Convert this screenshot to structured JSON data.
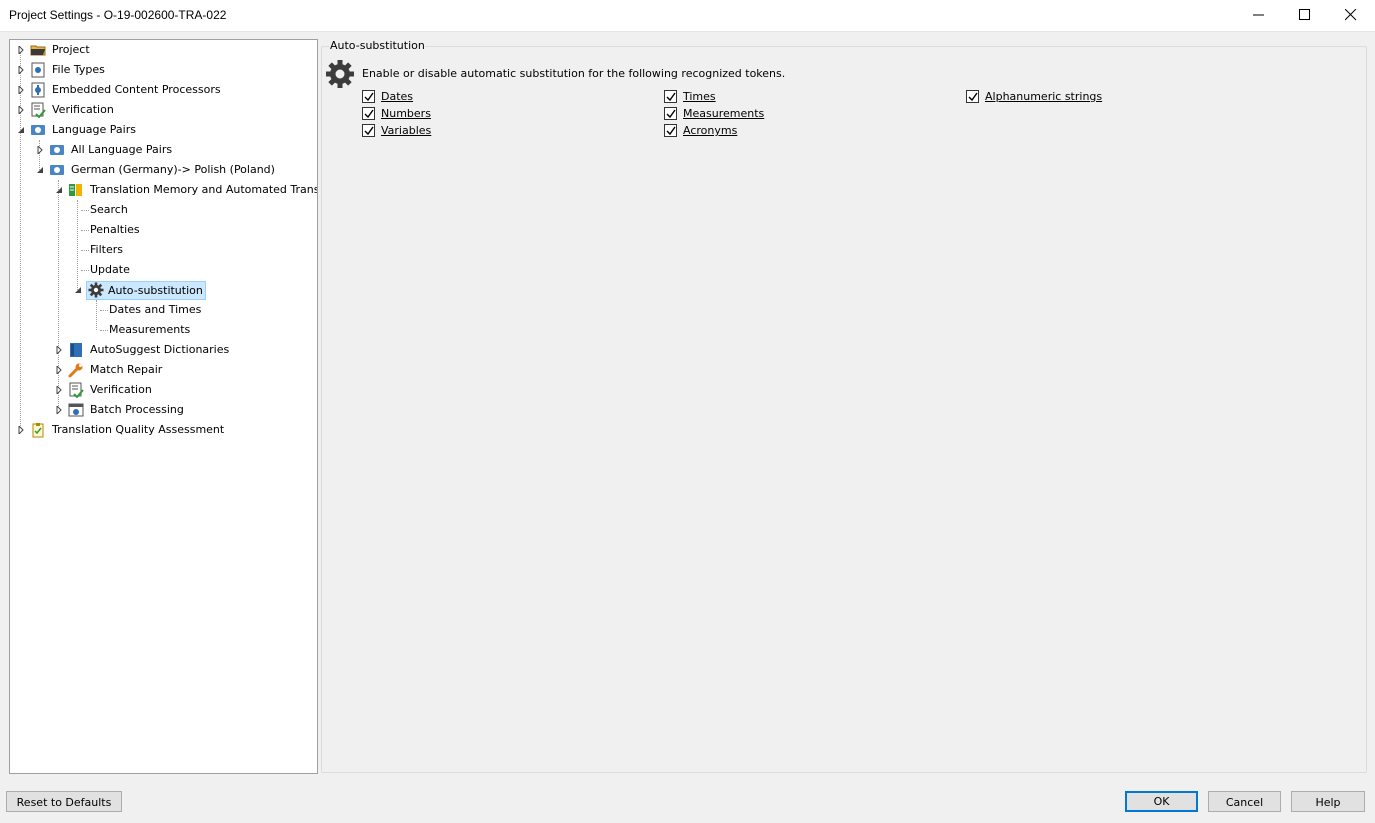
{
  "window": {
    "title": "Project Settings - O-19-002600-TRA-022",
    "minimize_icon": "minimize-icon",
    "maximize_icon": "maximize-icon",
    "close_icon": "close-icon"
  },
  "tree": {
    "items": [
      {
        "label": "Project",
        "icon": "project-folder-icon",
        "level": 0,
        "expander": "collapsed"
      },
      {
        "label": "File Types",
        "icon": "file-types-icon",
        "level": 0,
        "expander": "collapsed"
      },
      {
        "label": "Embedded Content Processors",
        "icon": "embedded-content-icon",
        "level": 0,
        "expander": "collapsed"
      },
      {
        "label": "Verification",
        "icon": "verification-icon",
        "level": 0,
        "expander": "collapsed"
      },
      {
        "label": "Language Pairs",
        "icon": "language-pairs-icon",
        "level": 0,
        "expander": "expanded"
      },
      {
        "label": "All Language Pairs",
        "icon": "language-pairs-icon",
        "level": 1,
        "expander": "collapsed"
      },
      {
        "label": "German (Germany)-> Polish (Poland)",
        "icon": "language-pairs-icon",
        "level": 1,
        "expander": "expanded"
      },
      {
        "label": "Translation Memory and Automated Translati",
        "icon": "translation-memory-icon",
        "level": 2,
        "expander": "expanded"
      },
      {
        "label": "Search",
        "icon": "",
        "level": 3,
        "expander": "none"
      },
      {
        "label": "Penalties",
        "icon": "",
        "level": 3,
        "expander": "none"
      },
      {
        "label": "Filters",
        "icon": "",
        "level": 3,
        "expander": "none"
      },
      {
        "label": "Update",
        "icon": "",
        "level": 3,
        "expander": "none"
      },
      {
        "label": "Auto-substitution",
        "icon": "gear-icon",
        "level": 3,
        "expander": "expanded",
        "selected": true
      },
      {
        "label": "Dates and Times",
        "icon": "",
        "level": 4,
        "expander": "none"
      },
      {
        "label": "Measurements",
        "icon": "",
        "level": 4,
        "expander": "none"
      },
      {
        "label": "AutoSuggest Dictionaries",
        "icon": "autosuggest-dictionary-icon",
        "level": 2,
        "expander": "collapsed"
      },
      {
        "label": "Match Repair",
        "icon": "wrench-icon",
        "level": 2,
        "expander": "collapsed"
      },
      {
        "label": "Verification",
        "icon": "verification-icon",
        "level": 2,
        "expander": "collapsed"
      },
      {
        "label": "Batch Processing",
        "icon": "batch-processing-icon",
        "level": 2,
        "expander": "collapsed"
      },
      {
        "label": "Translation Quality Assessment",
        "icon": "quality-assessment-icon",
        "level": 0,
        "expander": "collapsed"
      }
    ]
  },
  "panel": {
    "title": "Auto-substitution",
    "description": "Enable or disable automatic substitution for the following recognized tokens.",
    "icon": "gear-icon",
    "checkboxes": [
      {
        "label": "Dates",
        "checked": true
      },
      {
        "label": "Numbers",
        "checked": true
      },
      {
        "label": "Variables",
        "checked": true
      },
      {
        "label": "Times",
        "checked": true
      },
      {
        "label": "Measurements",
        "checked": true
      },
      {
        "label": "Acronyms",
        "checked": true
      },
      {
        "label": "Alphanumeric strings",
        "checked": true
      }
    ]
  },
  "buttons": {
    "reset": "Reset to Defaults",
    "ok": "OK",
    "cancel": "Cancel",
    "help": "Help"
  },
  "colors": {
    "selection_bg": "#cce8ff",
    "selection_border": "#99d1ff",
    "default_button_border": "#0078d7",
    "window_bg": "#f0f0f0"
  }
}
